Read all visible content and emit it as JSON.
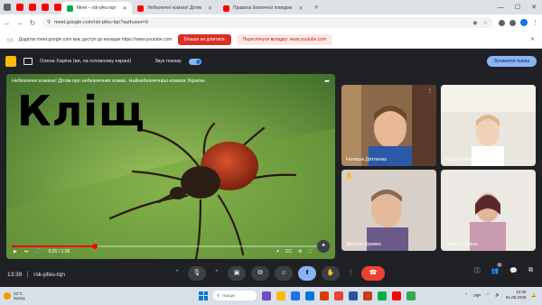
{
  "browser": {
    "tabs": [
      {
        "title": "Meet – rsk-pfeu-tqn",
        "active": true,
        "favicon_color": "#00ac47"
      },
      {
        "title": "Небезпечні комахи! Дітям",
        "active": false,
        "favicon_color": "#ff0000"
      },
      {
        "title": "Правила безпечної поведінк",
        "active": false,
        "favicon_color": "#ff0000"
      }
    ],
    "new_tab": "+",
    "url": "meet.google.com/rsk-pfeu-tqn?authuser=0"
  },
  "share_notice": {
    "message": "Додаток meet.google.com має доступ до вкладки https://www.youtube.com",
    "stop_label": "Більше не ділитися",
    "switch_label": "Переглянути вкладку: www.youtube.com"
  },
  "meet_header": {
    "presenter_text": "Олена Харіна (ви, на головному екрані)",
    "sound_label": "Звук показу",
    "stop_label": "Зупинити показ"
  },
  "presentation": {
    "video_title": "Небезпечні комахи! Дітям про небезпечних комах. Найнебезпечніші комахи України.",
    "big_word": "Кліщ",
    "current_time": "0:25 / 1:38",
    "progress": 0.26
  },
  "participants": [
    {
      "name": "Наташа Дятленко",
      "hand": false
    },
    {
      "name": "Надя Приходнюк",
      "hand": false
    },
    {
      "name": "Дмитро Кривих",
      "hand": true
    },
    {
      "name": "Олена Харіна",
      "hand": false
    }
  ],
  "bottom": {
    "time": "13:39",
    "meeting_code": "rsk-pfeu-tqn",
    "people_count": "5"
  },
  "taskbar": {
    "temperature": "23°C",
    "weather": "Sunny",
    "search_placeholder": "Пошук",
    "language": "УКР",
    "time": "13:39",
    "date": "01.05.2025"
  }
}
